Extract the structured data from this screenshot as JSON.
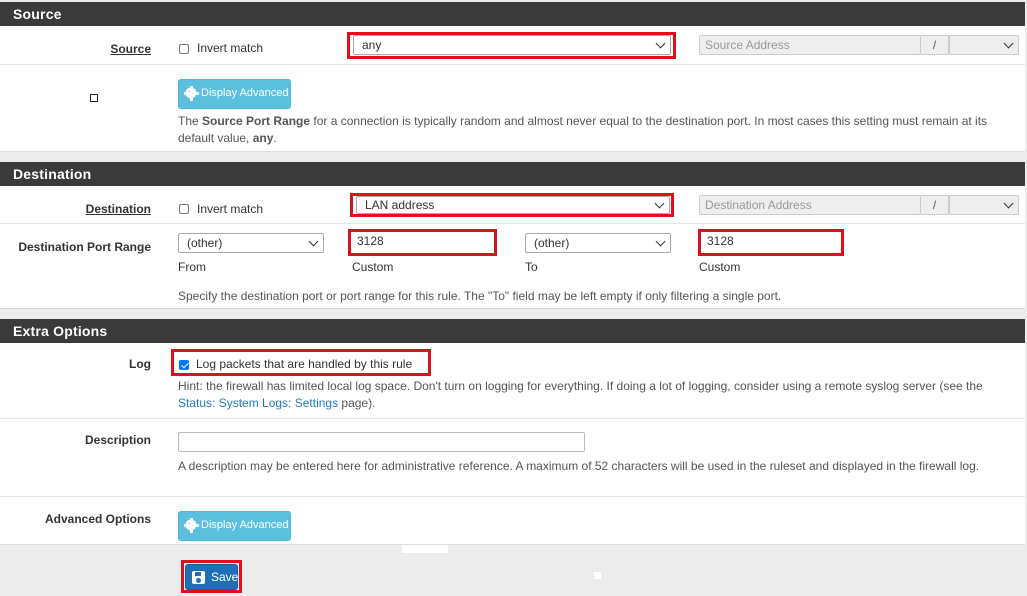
{
  "source": {
    "heading": "Source",
    "label": "Source",
    "invert_label": "Invert match",
    "type_value": "any",
    "address_placeholder": "Source Address",
    "slash": "/",
    "display_advanced": "Display Advanced",
    "help_prefix": "The ",
    "help_bold": "Source Port Range",
    "help_middle": " for a connection is typically random and almost never equal to the destination port. In most cases this setting must remain at its default value, ",
    "help_bold2": "any",
    "help_suffix": "."
  },
  "destination": {
    "heading": "Destination",
    "label": "Destination",
    "invert_label": "Invert match",
    "type_value": "LAN address",
    "address_placeholder": "Destination Address",
    "slash": "/",
    "port_range_label": "Destination Port Range",
    "from_select": "(other)",
    "from_custom": "3128",
    "from_label": "From",
    "custom_label": "Custom",
    "to_select": "(other)",
    "to_custom": "3128",
    "to_label": "To",
    "custom_label2": "Custom",
    "help": "Specify the destination port or port range for this rule. The \"To\" field may be left empty if only filtering a single port."
  },
  "extra": {
    "heading": "Extra Options",
    "log_label": "Log",
    "log_checkbox_label": "Log packets that are handled by this rule",
    "log_checked": true,
    "log_hint_prefix": "Hint: the firewall has limited local log space. Don't turn on logging for everything. If doing a lot of logging, consider using a remote syslog server (see the ",
    "log_hint_link": "Status: System Logs: Settings",
    "log_hint_suffix": " page).",
    "description_label": "Description",
    "description_value": "",
    "description_help": "A description may be entered here for administrative reference. A maximum of 52 characters will be used in the ruleset and displayed in the firewall log.",
    "advanced_label": "Advanced Options",
    "display_advanced": "Display Advanced"
  },
  "footer": {
    "save_label": "Save"
  },
  "colors": {
    "highlight": "#e0101a",
    "heading_bg": "#3a3a3a",
    "info_button": "#5bc0de",
    "primary_button": "#1e6fb5"
  }
}
